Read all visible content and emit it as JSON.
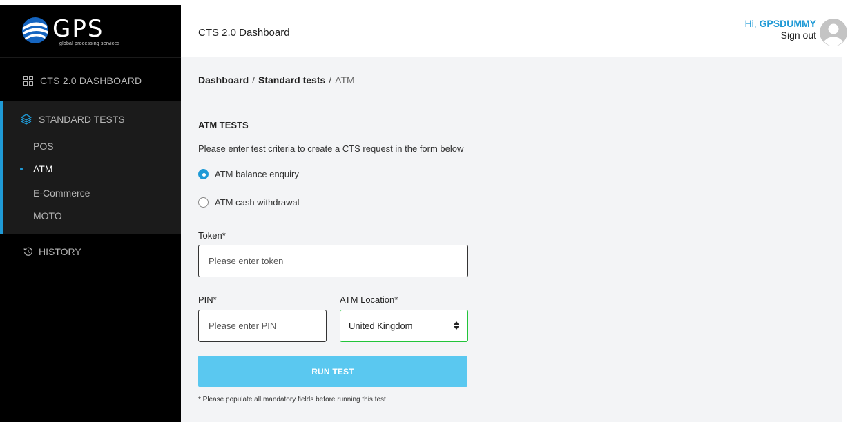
{
  "brand": {
    "logo_text": "GPS",
    "logo_subtitle": "global processing services"
  },
  "sidebar": {
    "dashboard_label": "CTS 2.0 DASHBOARD",
    "standard_tests_label": "STANDARD TESTS",
    "sub_items": [
      "POS",
      "ATM",
      "E-Commerce",
      "MOTO"
    ],
    "active_sub_item": "ATM",
    "history_label": "HISTORY",
    "accent_color": "#1f9ad6"
  },
  "header": {
    "title": "CTS 2.0 Dashboard",
    "greeting": "Hi,",
    "username": "GPSDUMMY",
    "signout": "Sign out"
  },
  "breadcrumb": {
    "items": [
      "Dashboard",
      "Standard tests",
      "ATM"
    ],
    "separator": "/"
  },
  "form": {
    "section_title": "ATM TESTS",
    "instruction": "Please enter test criteria to create a CTS request in the form below",
    "radio_options": [
      {
        "label": "ATM balance enquiry",
        "checked": true
      },
      {
        "label": "ATM cash withdrawal",
        "checked": false
      }
    ],
    "token_label": "Token*",
    "token_placeholder": "Please enter token",
    "pin_label": "PIN*",
    "pin_placeholder": "Please enter PIN",
    "location_label": "ATM Location*",
    "location_value": "United Kingdom",
    "run_button": "RUN TEST",
    "note": "* Please populate all mandatory fields before running this test",
    "button_color": "#5ac8f0",
    "select_border_color": "#22c43a"
  }
}
